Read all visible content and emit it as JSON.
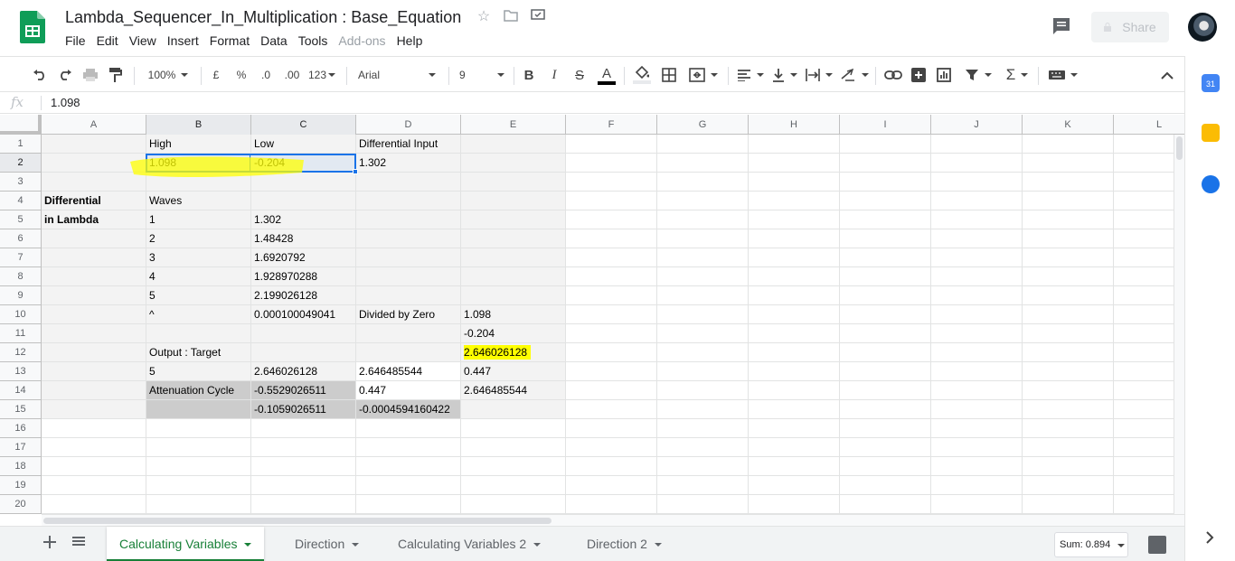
{
  "header": {
    "title": "Lambda_Sequencer_In_Multiplication : Base_Equation",
    "menu": [
      "File",
      "Edit",
      "View",
      "Insert",
      "Format",
      "Data",
      "Tools",
      "Add-ons",
      "Help"
    ],
    "share_label": "Share"
  },
  "toolbar": {
    "zoom": "100%",
    "currency": "£",
    "percent": "%",
    "dec_decrease": ".0",
    "dec_increase": ".00",
    "more_formats": "123",
    "font": "Arial",
    "font_size": "9",
    "bold": "B",
    "italic": "I",
    "strike": "S",
    "text_color_label": "A",
    "text_color": "#000000"
  },
  "formula_bar": {
    "fx": "fx",
    "value": "1.098"
  },
  "columns": [
    "A",
    "B",
    "C",
    "D",
    "E",
    "F",
    "G",
    "H",
    "I",
    "J",
    "K",
    "L"
  ],
  "rows": [
    "1",
    "2",
    "3",
    "4",
    "5",
    "6",
    "7",
    "8",
    "9",
    "10",
    "11",
    "12",
    "13",
    "14",
    "15",
    "16",
    "17",
    "18",
    "19",
    "20"
  ],
  "cells": {
    "B1": "High",
    "C1": "Low",
    "D1": "Differential Input",
    "B2": "1.098",
    "C2": "-0.204",
    "D2": "1.302",
    "A4": "Differential",
    "B4": "Waves",
    "A5": "in Lambda",
    "B5": "1",
    "C5": "1.302",
    "B6": "2",
    "C6": "1.48428",
    "B7": "3",
    "C7": "1.6920792",
    "B8": "4",
    "C8": "1.928970288",
    "B9": "5",
    "C9": "2.199026128",
    "B10": "^",
    "C10": "0.000100049041",
    "D10": "Divided by Zero",
    "E10": "1.098",
    "E11": "-0.204",
    "B12": "Output : Target",
    "E12": "2.646026128",
    "B13": "5",
    "C13": "2.646026128",
    "D13": "2.646485544",
    "E13": "0.447",
    "B14": "Attenuation Cycle",
    "C14": "-0.5529026511",
    "D14": "0.447",
    "E14": "2.646485544",
    "C15": "-0.1059026511",
    "D15": "-0.0004594160422"
  },
  "colors": {
    "highlight_yellow": "#ffff00",
    "selection_blue": "#1a73e8",
    "tab_active_green": "#188038",
    "cell_shade": "#f3f3f3",
    "cell_dark": "#cccccc"
  },
  "sheet_tabs": [
    "Calculating Variables",
    "Direction",
    "Calculating Variables  2",
    "Direction  2"
  ],
  "active_tab": "Calculating Variables",
  "sum_label": "Sum: 0.894",
  "side_panel": {
    "calendar_day": "31"
  }
}
